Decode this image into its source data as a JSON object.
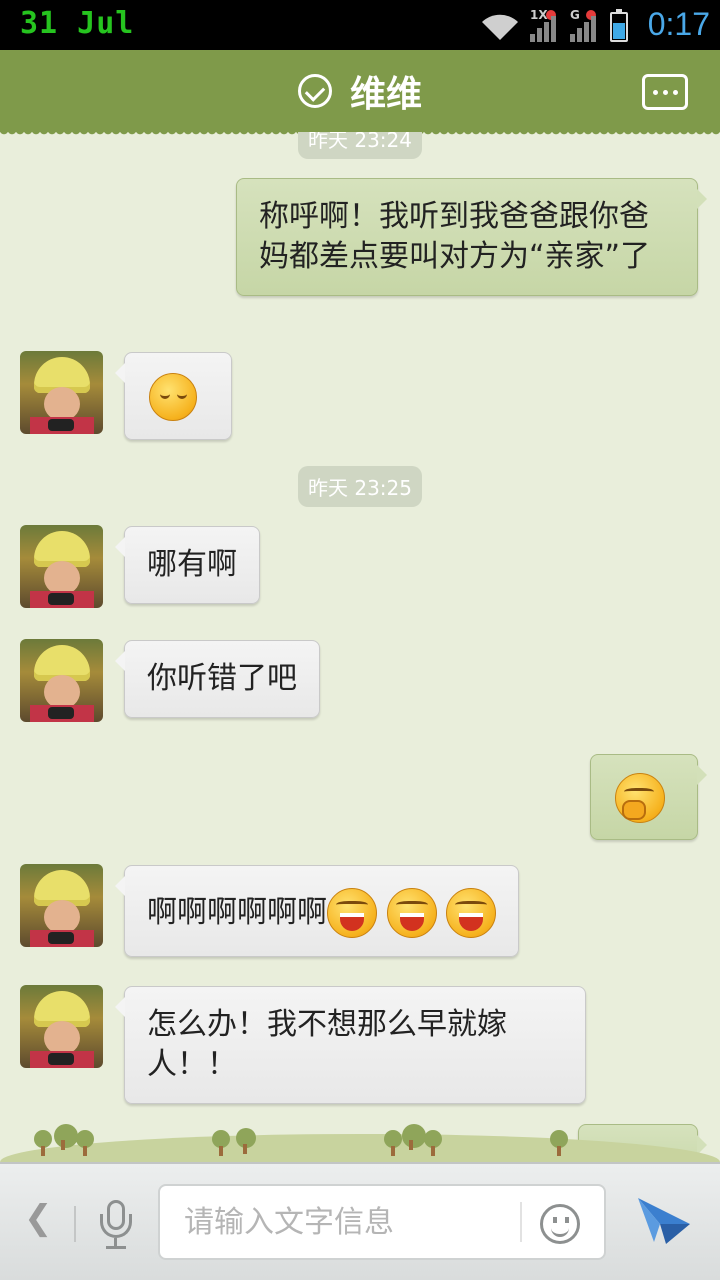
{
  "status_bar": {
    "date": "31 Jul",
    "net1_label": "1X",
    "net2_label": "G",
    "time": "0:17"
  },
  "header": {
    "title": "维维"
  },
  "messages": [
    {
      "type": "time",
      "text": "昨天 23:24"
    },
    {
      "type": "out",
      "text": "称呼啊！我听到我爸爸跟你爸妈都差点要叫对方为“亲家”了"
    },
    {
      "type": "in",
      "emoji": "sleepy-emoji"
    },
    {
      "type": "time",
      "text": "昨天 23:25"
    },
    {
      "type": "in",
      "text": "哪有啊"
    },
    {
      "type": "in",
      "text": "你听错了吧"
    },
    {
      "type": "out",
      "emoji": "shy-emoji"
    },
    {
      "type": "in",
      "text": "啊啊啊啊啊啊",
      "emoji": "laugh-emoji"
    },
    {
      "type": "in",
      "text": "怎么办！我不想那么早就嫁人！！"
    }
  ],
  "input": {
    "placeholder": "请输入文字信息"
  },
  "colors": {
    "header": "#7f9a4a",
    "background": "#e9eedb",
    "outgoing_bubble": "#cfdcb3",
    "incoming_bubble": "#eeeeee",
    "time_accent": "#4aa8e8"
  }
}
